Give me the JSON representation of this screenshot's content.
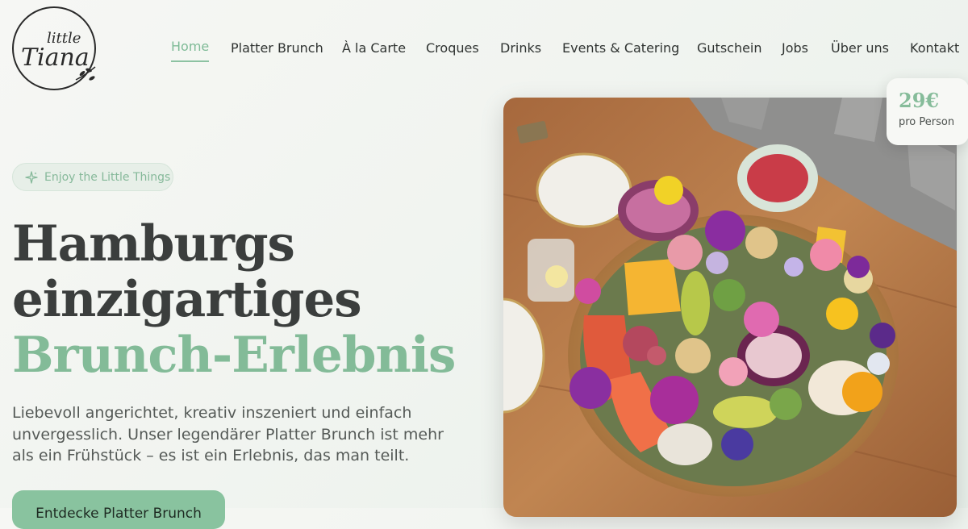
{
  "brand": {
    "logo_line1": "little",
    "logo_line2": "Tiana"
  },
  "nav": {
    "items": [
      {
        "label": "Home"
      },
      {
        "label": "Platter Brunch"
      },
      {
        "label": "À la Carte"
      },
      {
        "label": "Croques"
      },
      {
        "label": "Drinks"
      },
      {
        "label": "Events & Catering"
      },
      {
        "label": "Gutschein"
      },
      {
        "label": "Jobs"
      },
      {
        "label": "Über uns"
      },
      {
        "label": "Kontakt"
      }
    ],
    "active": "Home"
  },
  "hero": {
    "badge": "Enjoy the Little Things",
    "headline_line1": "Hamburgs",
    "headline_line2": "einzigartiges",
    "headline_accent": "Brunch-Erlebnis",
    "description": "Liebevoll angerichtet, kreativ inszeniert und einfach unvergesslich. Unser legendärer Platter Brunch ist mehr als ein Frühstück – es ist ein Erlebnis, das man teilt.",
    "cta_label": "Entdecke Platter Brunch"
  },
  "price_card": {
    "value": "29€",
    "unit": "pro Person"
  },
  "colors": {
    "accent": "#83bb98",
    "text": "#3b3e3d",
    "background": "#f4f6f2"
  }
}
